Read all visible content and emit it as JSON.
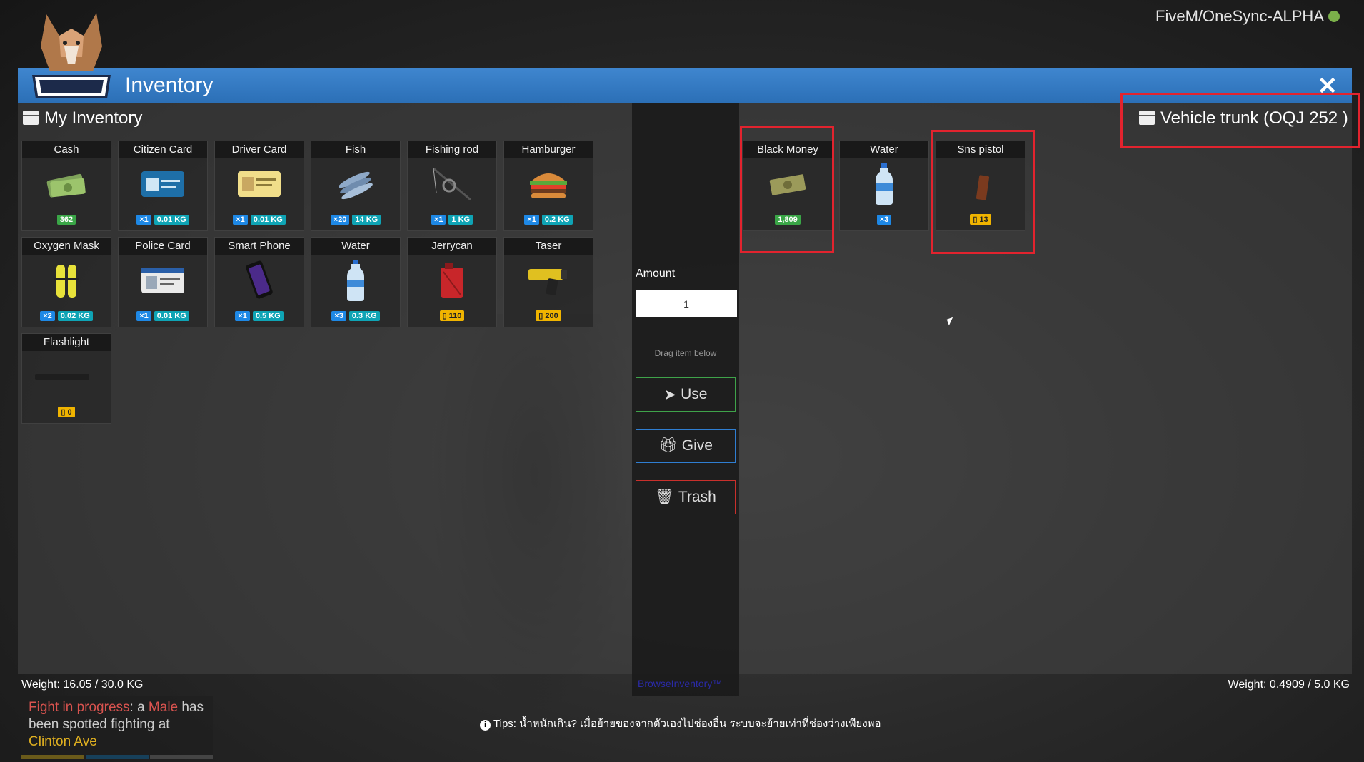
{
  "server": {
    "label": "FiveM/OneSync-ALPHA"
  },
  "window": {
    "title": "Inventory",
    "close_icon": "close-icon"
  },
  "my_inventory": {
    "title": "My Inventory",
    "items": [
      {
        "name": "Cash",
        "icon": "cash-icon",
        "badges": [
          {
            "type": "money",
            "text": "362"
          }
        ]
      },
      {
        "name": "Citizen Card",
        "icon": "id-card-icon",
        "badges": [
          {
            "type": "count",
            "text": "×1"
          },
          {
            "type": "weight",
            "text": "0.01 KG"
          }
        ]
      },
      {
        "name": "Driver Card",
        "icon": "driver-card-icon",
        "badges": [
          {
            "type": "count",
            "text": "×1"
          },
          {
            "type": "weight",
            "text": "0.01 KG"
          }
        ]
      },
      {
        "name": "Fish",
        "icon": "fish-icon",
        "badges": [
          {
            "type": "count",
            "text": "×20"
          },
          {
            "type": "weight",
            "text": "14 KG"
          }
        ]
      },
      {
        "name": "Fishing rod",
        "icon": "fishing-rod-icon",
        "badges": [
          {
            "type": "count",
            "text": "×1"
          },
          {
            "type": "weight",
            "text": "1 KG"
          }
        ]
      },
      {
        "name": "Hamburger",
        "icon": "hamburger-icon",
        "badges": [
          {
            "type": "count",
            "text": "×1"
          },
          {
            "type": "weight",
            "text": "0.2 KG"
          }
        ]
      },
      {
        "name": "Oxygen Mask",
        "icon": "oxygen-mask-icon",
        "badges": [
          {
            "type": "count",
            "text": "×2"
          },
          {
            "type": "weight",
            "text": "0.02 KG"
          }
        ]
      },
      {
        "name": "Police Card",
        "icon": "police-card-icon",
        "badges": [
          {
            "type": "count",
            "text": "×1"
          },
          {
            "type": "weight",
            "text": "0.01 KG"
          }
        ]
      },
      {
        "name": "Smart Phone",
        "icon": "phone-icon",
        "badges": [
          {
            "type": "count",
            "text": "×1"
          },
          {
            "type": "weight",
            "text": "0.5 KG"
          }
        ]
      },
      {
        "name": "Water",
        "icon": "water-bottle-icon",
        "badges": [
          {
            "type": "count",
            "text": "×3"
          },
          {
            "type": "weight",
            "text": "0.3 KG"
          }
        ]
      },
      {
        "name": "Jerrycan",
        "icon": "jerrycan-icon",
        "badges": [
          {
            "type": "ammo",
            "text": "▯ 110"
          }
        ]
      },
      {
        "name": "Taser",
        "icon": "taser-icon",
        "badges": [
          {
            "type": "ammo",
            "text": "▯ 200"
          }
        ]
      },
      {
        "name": "Flashlight",
        "icon": "flashlight-icon",
        "badges": [
          {
            "type": "ammo",
            "text": "▯ 0"
          }
        ]
      }
    ],
    "weight": "Weight: 16.05 / 30.0 KG"
  },
  "actions": {
    "amount_label": "Amount",
    "amount_value": "1",
    "drag_hint": "Drag item below",
    "use_label": "Use",
    "give_label": "Give",
    "trash_label": "Trash",
    "brand": "BrowseInventory™"
  },
  "trunk": {
    "title": "Vehicle trunk (OQJ 252 )",
    "items": [
      {
        "name": "Black Money",
        "icon": "black-money-icon",
        "badges": [
          {
            "type": "money",
            "text": "1,809"
          }
        ]
      },
      {
        "name": "Water",
        "icon": "water-bottle-icon",
        "badges": [
          {
            "type": "count",
            "text": "×3"
          }
        ]
      },
      {
        "name": "Sns pistol",
        "icon": "pistol-icon",
        "badges": [
          {
            "type": "ammo",
            "text": "▯ 13"
          }
        ]
      }
    ],
    "weight": "Weight: 0.4909 / 5.0 KG"
  },
  "tips": {
    "text": "Tips: น้ำหนักเกิน? เมื่อย้ายของจากตัวเองไปช่องอื่น ระบบจะย้ายเท่าที่ช่องว่างเพียงพอ"
  },
  "notification": {
    "part1": "Fight in progress",
    "part2": ": a ",
    "part3": "Male",
    "part4": " has been spotted fighting at ",
    "part5": "Clinton Ave"
  },
  "colors": {
    "titlebar": "#2b6fb6",
    "highlight": "#e2232e",
    "use": "#3fa34a",
    "give": "#2f7ed2",
    "trash": "#c9302c"
  }
}
